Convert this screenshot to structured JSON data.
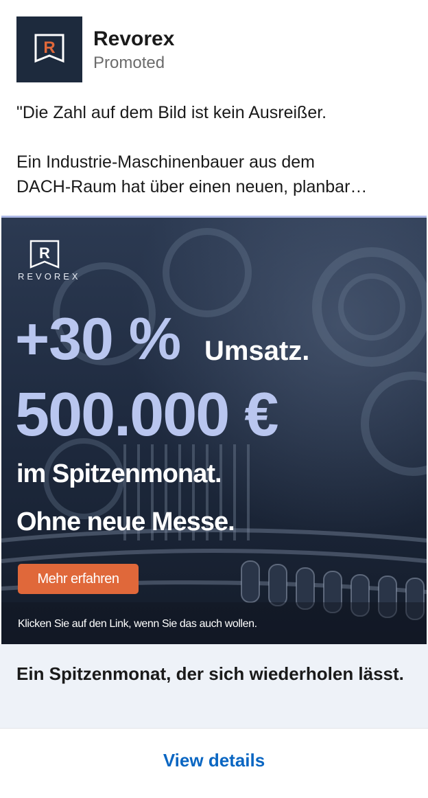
{
  "post": {
    "company_name": "Revorex",
    "promoted_label": "Promoted",
    "text_lines": [
      "\"Die Zahl auf dem Bild ist kein Ausreißer.",
      "Ein Industrie-Maschinenbauer aus dem",
      "DACH-Raum hat über einen neuen, planbar…"
    ]
  },
  "creative": {
    "brand_wordmark": "REVOREX",
    "brand_letter": "R",
    "stat_1": "+30 %",
    "stat_1_suffix": "Umsatz.",
    "stat_2": "500.000 €",
    "line_3": "im Spitzenmonat.",
    "line_4": "Ohne neue Messe.",
    "cta_label": "Mehr erfahren",
    "disclaimer": "Klicken Sie auf den Link, wenn Sie das auch wollen."
  },
  "headline": "Ein Spitzenmonat, der sich wiederholen lässt.",
  "footer": {
    "view_details_label": "View details"
  },
  "colors": {
    "accent_link": "#0a66c2",
    "cta_orange": "#e0683a",
    "stat_lavender": "#b9c6ef",
    "brand_navy": "#1d2a3d"
  },
  "icons": [
    "revorex-logo-icon",
    "gears-chain-background-image"
  ]
}
